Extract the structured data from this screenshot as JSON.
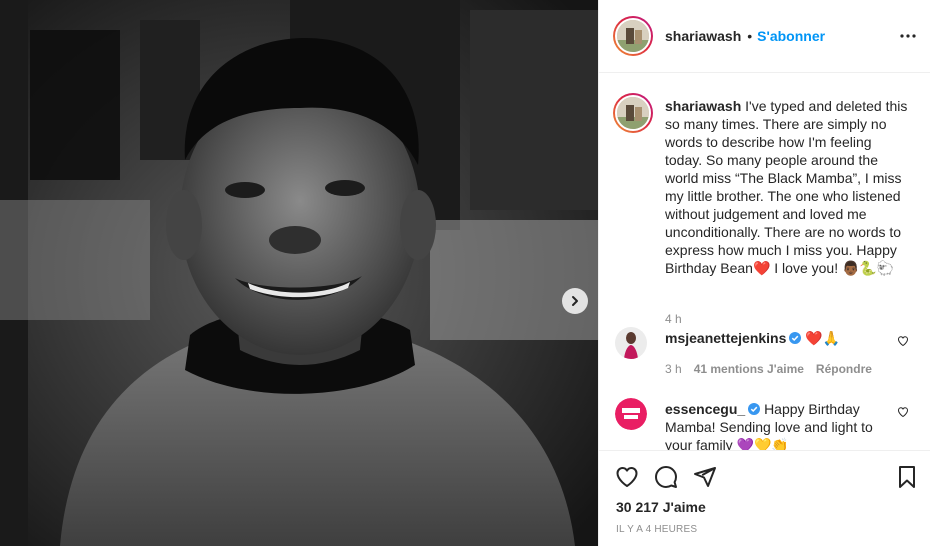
{
  "post": {
    "username": "shariawash",
    "dot": "•",
    "follow_label": "S'abonner",
    "more_label": "•••"
  },
  "caption": {
    "username": "shariawash",
    "text": "I've typed and deleted this so many times. There are simply no words to describe how I'm feeling today. So many people around the world miss “The Black Mamba”, I miss my little brother. The one who listened without judgement and loved me unconditionally. There are no words to express how much I miss you. Happy Birthday Bean❤️  I love you! 👨🏾🐍🐑",
    "time": "4 h"
  },
  "comments": [
    {
      "username": "msjeanettejenkins",
      "text": "❤️🙏",
      "time": "3 h",
      "likes": "41 mentions J'aime",
      "reply": "Répondre"
    },
    {
      "username": "essencegu_",
      "text": "Happy Birthday Mamba! Sending love and light to your family 💜💛👏"
    }
  ],
  "footer": {
    "likes": "30 217 J'aime",
    "time_ago": "IL Y A 4 HEURES"
  },
  "icons": {
    "next": "chevron-right-icon",
    "like": "heart-icon",
    "comment": "comment-icon",
    "share": "paper-plane-icon",
    "save": "bookmark-icon",
    "verified": "verified-badge-icon"
  },
  "colors": {
    "link": "#0095f6",
    "verified": "#3897f0",
    "muted": "#8e8e8e",
    "border": "#efefef"
  }
}
